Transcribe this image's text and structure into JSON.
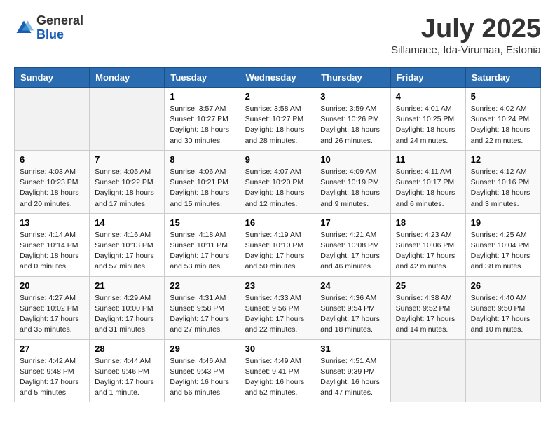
{
  "logo": {
    "general": "General",
    "blue": "Blue"
  },
  "header": {
    "month": "July 2025",
    "location": "Sillamaee, Ida-Virumaa, Estonia"
  },
  "weekdays": [
    "Sunday",
    "Monday",
    "Tuesday",
    "Wednesday",
    "Thursday",
    "Friday",
    "Saturday"
  ],
  "weeks": [
    [
      {
        "day": null
      },
      {
        "day": null
      },
      {
        "day": "1",
        "sunrise": "Sunrise: 3:57 AM",
        "sunset": "Sunset: 10:27 PM",
        "daylight": "Daylight: 18 hours and 30 minutes."
      },
      {
        "day": "2",
        "sunrise": "Sunrise: 3:58 AM",
        "sunset": "Sunset: 10:27 PM",
        "daylight": "Daylight: 18 hours and 28 minutes."
      },
      {
        "day": "3",
        "sunrise": "Sunrise: 3:59 AM",
        "sunset": "Sunset: 10:26 PM",
        "daylight": "Daylight: 18 hours and 26 minutes."
      },
      {
        "day": "4",
        "sunrise": "Sunrise: 4:01 AM",
        "sunset": "Sunset: 10:25 PM",
        "daylight": "Daylight: 18 hours and 24 minutes."
      },
      {
        "day": "5",
        "sunrise": "Sunrise: 4:02 AM",
        "sunset": "Sunset: 10:24 PM",
        "daylight": "Daylight: 18 hours and 22 minutes."
      }
    ],
    [
      {
        "day": "6",
        "sunrise": "Sunrise: 4:03 AM",
        "sunset": "Sunset: 10:23 PM",
        "daylight": "Daylight: 18 hours and 20 minutes."
      },
      {
        "day": "7",
        "sunrise": "Sunrise: 4:05 AM",
        "sunset": "Sunset: 10:22 PM",
        "daylight": "Daylight: 18 hours and 17 minutes."
      },
      {
        "day": "8",
        "sunrise": "Sunrise: 4:06 AM",
        "sunset": "Sunset: 10:21 PM",
        "daylight": "Daylight: 18 hours and 15 minutes."
      },
      {
        "day": "9",
        "sunrise": "Sunrise: 4:07 AM",
        "sunset": "Sunset: 10:20 PM",
        "daylight": "Daylight: 18 hours and 12 minutes."
      },
      {
        "day": "10",
        "sunrise": "Sunrise: 4:09 AM",
        "sunset": "Sunset: 10:19 PM",
        "daylight": "Daylight: 18 hours and 9 minutes."
      },
      {
        "day": "11",
        "sunrise": "Sunrise: 4:11 AM",
        "sunset": "Sunset: 10:17 PM",
        "daylight": "Daylight: 18 hours and 6 minutes."
      },
      {
        "day": "12",
        "sunrise": "Sunrise: 4:12 AM",
        "sunset": "Sunset: 10:16 PM",
        "daylight": "Daylight: 18 hours and 3 minutes."
      }
    ],
    [
      {
        "day": "13",
        "sunrise": "Sunrise: 4:14 AM",
        "sunset": "Sunset: 10:14 PM",
        "daylight": "Daylight: 18 hours and 0 minutes."
      },
      {
        "day": "14",
        "sunrise": "Sunrise: 4:16 AM",
        "sunset": "Sunset: 10:13 PM",
        "daylight": "Daylight: 17 hours and 57 minutes."
      },
      {
        "day": "15",
        "sunrise": "Sunrise: 4:18 AM",
        "sunset": "Sunset: 10:11 PM",
        "daylight": "Daylight: 17 hours and 53 minutes."
      },
      {
        "day": "16",
        "sunrise": "Sunrise: 4:19 AM",
        "sunset": "Sunset: 10:10 PM",
        "daylight": "Daylight: 17 hours and 50 minutes."
      },
      {
        "day": "17",
        "sunrise": "Sunrise: 4:21 AM",
        "sunset": "Sunset: 10:08 PM",
        "daylight": "Daylight: 17 hours and 46 minutes."
      },
      {
        "day": "18",
        "sunrise": "Sunrise: 4:23 AM",
        "sunset": "Sunset: 10:06 PM",
        "daylight": "Daylight: 17 hours and 42 minutes."
      },
      {
        "day": "19",
        "sunrise": "Sunrise: 4:25 AM",
        "sunset": "Sunset: 10:04 PM",
        "daylight": "Daylight: 17 hours and 38 minutes."
      }
    ],
    [
      {
        "day": "20",
        "sunrise": "Sunrise: 4:27 AM",
        "sunset": "Sunset: 10:02 PM",
        "daylight": "Daylight: 17 hours and 35 minutes."
      },
      {
        "day": "21",
        "sunrise": "Sunrise: 4:29 AM",
        "sunset": "Sunset: 10:00 PM",
        "daylight": "Daylight: 17 hours and 31 minutes."
      },
      {
        "day": "22",
        "sunrise": "Sunrise: 4:31 AM",
        "sunset": "Sunset: 9:58 PM",
        "daylight": "Daylight: 17 hours and 27 minutes."
      },
      {
        "day": "23",
        "sunrise": "Sunrise: 4:33 AM",
        "sunset": "Sunset: 9:56 PM",
        "daylight": "Daylight: 17 hours and 22 minutes."
      },
      {
        "day": "24",
        "sunrise": "Sunrise: 4:36 AM",
        "sunset": "Sunset: 9:54 PM",
        "daylight": "Daylight: 17 hours and 18 minutes."
      },
      {
        "day": "25",
        "sunrise": "Sunrise: 4:38 AM",
        "sunset": "Sunset: 9:52 PM",
        "daylight": "Daylight: 17 hours and 14 minutes."
      },
      {
        "day": "26",
        "sunrise": "Sunrise: 4:40 AM",
        "sunset": "Sunset: 9:50 PM",
        "daylight": "Daylight: 17 hours and 10 minutes."
      }
    ],
    [
      {
        "day": "27",
        "sunrise": "Sunrise: 4:42 AM",
        "sunset": "Sunset: 9:48 PM",
        "daylight": "Daylight: 17 hours and 5 minutes."
      },
      {
        "day": "28",
        "sunrise": "Sunrise: 4:44 AM",
        "sunset": "Sunset: 9:46 PM",
        "daylight": "Daylight: 17 hours and 1 minute."
      },
      {
        "day": "29",
        "sunrise": "Sunrise: 4:46 AM",
        "sunset": "Sunset: 9:43 PM",
        "daylight": "Daylight: 16 hours and 56 minutes."
      },
      {
        "day": "30",
        "sunrise": "Sunrise: 4:49 AM",
        "sunset": "Sunset: 9:41 PM",
        "daylight": "Daylight: 16 hours and 52 minutes."
      },
      {
        "day": "31",
        "sunrise": "Sunrise: 4:51 AM",
        "sunset": "Sunset: 9:39 PM",
        "daylight": "Daylight: 16 hours and 47 minutes."
      },
      {
        "day": null
      },
      {
        "day": null
      }
    ]
  ]
}
